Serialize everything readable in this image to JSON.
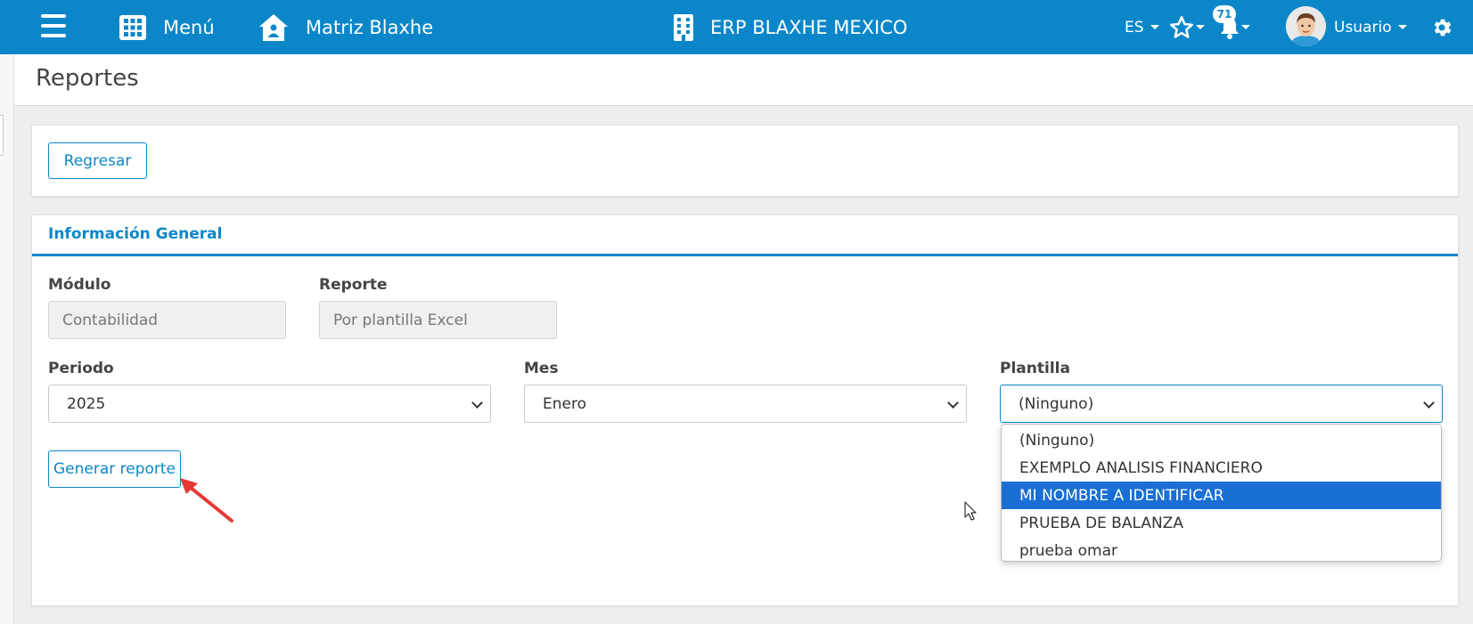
{
  "topbar": {
    "menu_label": "Menú",
    "home_label": "Matriz Blaxhe",
    "company_label": "ERP BLAXHE MEXICO",
    "language": "ES",
    "notification_count": "71",
    "user_label": "Usuario"
  },
  "page": {
    "title": "Reportes"
  },
  "actions": {
    "back_label": "Regresar"
  },
  "general": {
    "section_title": "Información General",
    "module_label": "Módulo",
    "module_value": "Contabilidad",
    "report_label": "Reporte",
    "report_value": "Por plantilla Excel",
    "period_label": "Periodo",
    "period_value": "2025",
    "month_label": "Mes",
    "month_value": "Enero",
    "template_label": "Plantilla",
    "template_value": "(Ninguno)",
    "generate_label": "Generar reporte"
  },
  "template_options": [
    {
      "label": "(Ninguno)",
      "selected": false
    },
    {
      "label": "EXEMPLO ANALISIS FINANCIERO",
      "selected": false
    },
    {
      "label": "MI NOMBRE A IDENTIFICAR",
      "selected": true
    },
    {
      "label": "PRUEBA DE BALANZA",
      "selected": false
    },
    {
      "label": "prueba omar",
      "selected": false
    }
  ],
  "colors": {
    "brand": "#0b87c9",
    "selected_option": "#1a6fd4",
    "annotation_arrow": "#e53935"
  }
}
